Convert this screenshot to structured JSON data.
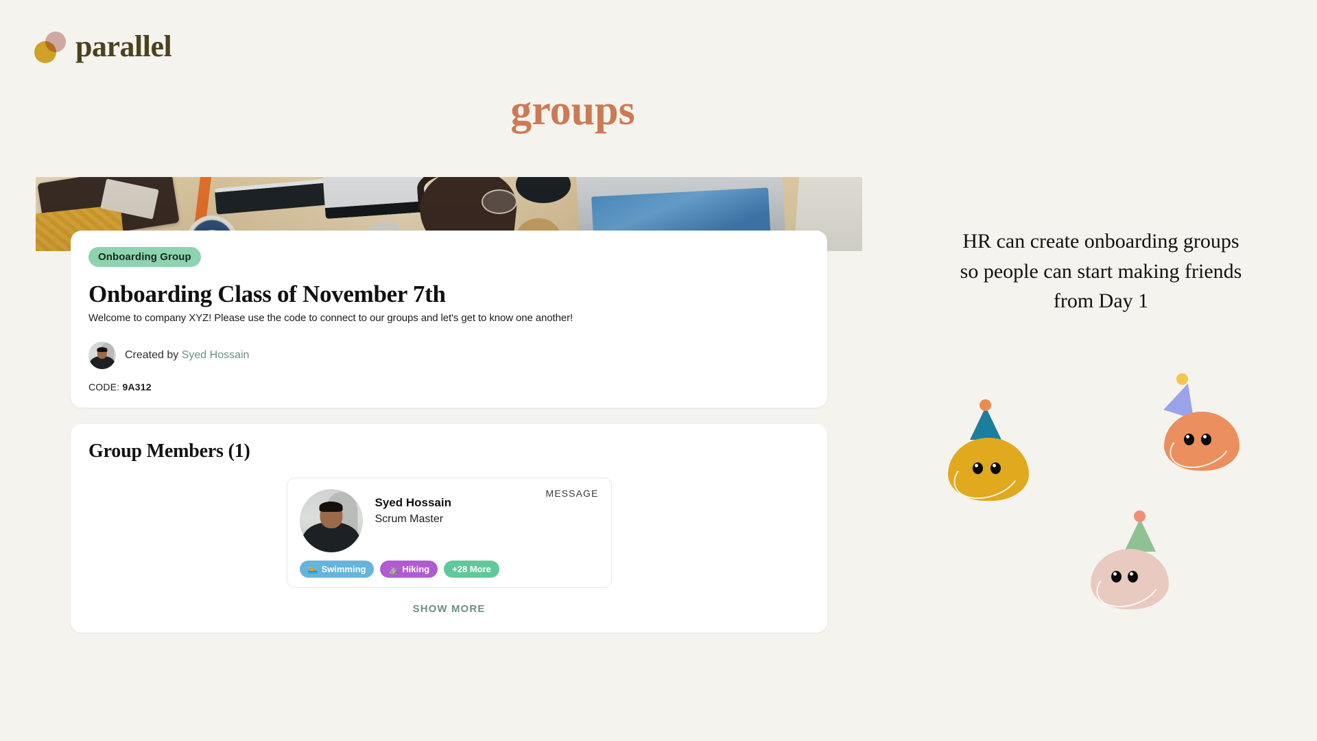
{
  "brand": {
    "name": "parallel",
    "logo_colors": {
      "gold": "#d0a028",
      "rose": "#d9b0ad",
      "text": "#4b431f"
    }
  },
  "page": {
    "heading": "groups",
    "heading_color": "#cb7a55",
    "background": "#f4f3ed"
  },
  "group": {
    "badge": "Onboarding Group",
    "badge_color": "#8ed3af",
    "title": "Onboarding Class of November 7th",
    "description": "Welcome to company XYZ! Please use the code to connect to our groups and let's get to know one another!",
    "created_by_label": "Created by",
    "created_by_name": "Syed Hossain",
    "code_label": "CODE:",
    "code_value": "9A312",
    "banner_alt": "desk-flat-lay-photo"
  },
  "members_section": {
    "title": "Group Members (1)",
    "show_more_label": "SHOW MORE",
    "members": [
      {
        "name": "Syed Hossain",
        "role": "Scrum Master",
        "message_label": "MESSAGE",
        "tags": [
          {
            "label": "Swimming",
            "emoji": "🏊",
            "color": "#66b3dc",
            "icon_name": "swimming-icon"
          },
          {
            "label": "Hiking",
            "emoji": "⛰️",
            "color": "#b05bd0",
            "icon_name": "mountain-icon"
          },
          {
            "label": "+28 More",
            "emoji": "",
            "color": "#5fc99a",
            "icon_name": ""
          }
        ]
      }
    ]
  },
  "caption": {
    "text": "HR can create onboarding groups so people can start making friends from Day 1"
  },
  "decorations": {
    "blobs": [
      {
        "name": "gold-blob",
        "body_color": "#e0a91e",
        "hat_color": "#1c7e9e",
        "pom_color": "#ec8b4e"
      },
      {
        "name": "orange-blob",
        "body_color": "#ea8f5d",
        "hat_color": "#9aa2ea",
        "pom_color": "#f7c44e"
      },
      {
        "name": "blush-blob",
        "body_color": "#e8cac0",
        "hat_color": "#8fc193",
        "pom_color": "#f08f77"
      }
    ]
  }
}
